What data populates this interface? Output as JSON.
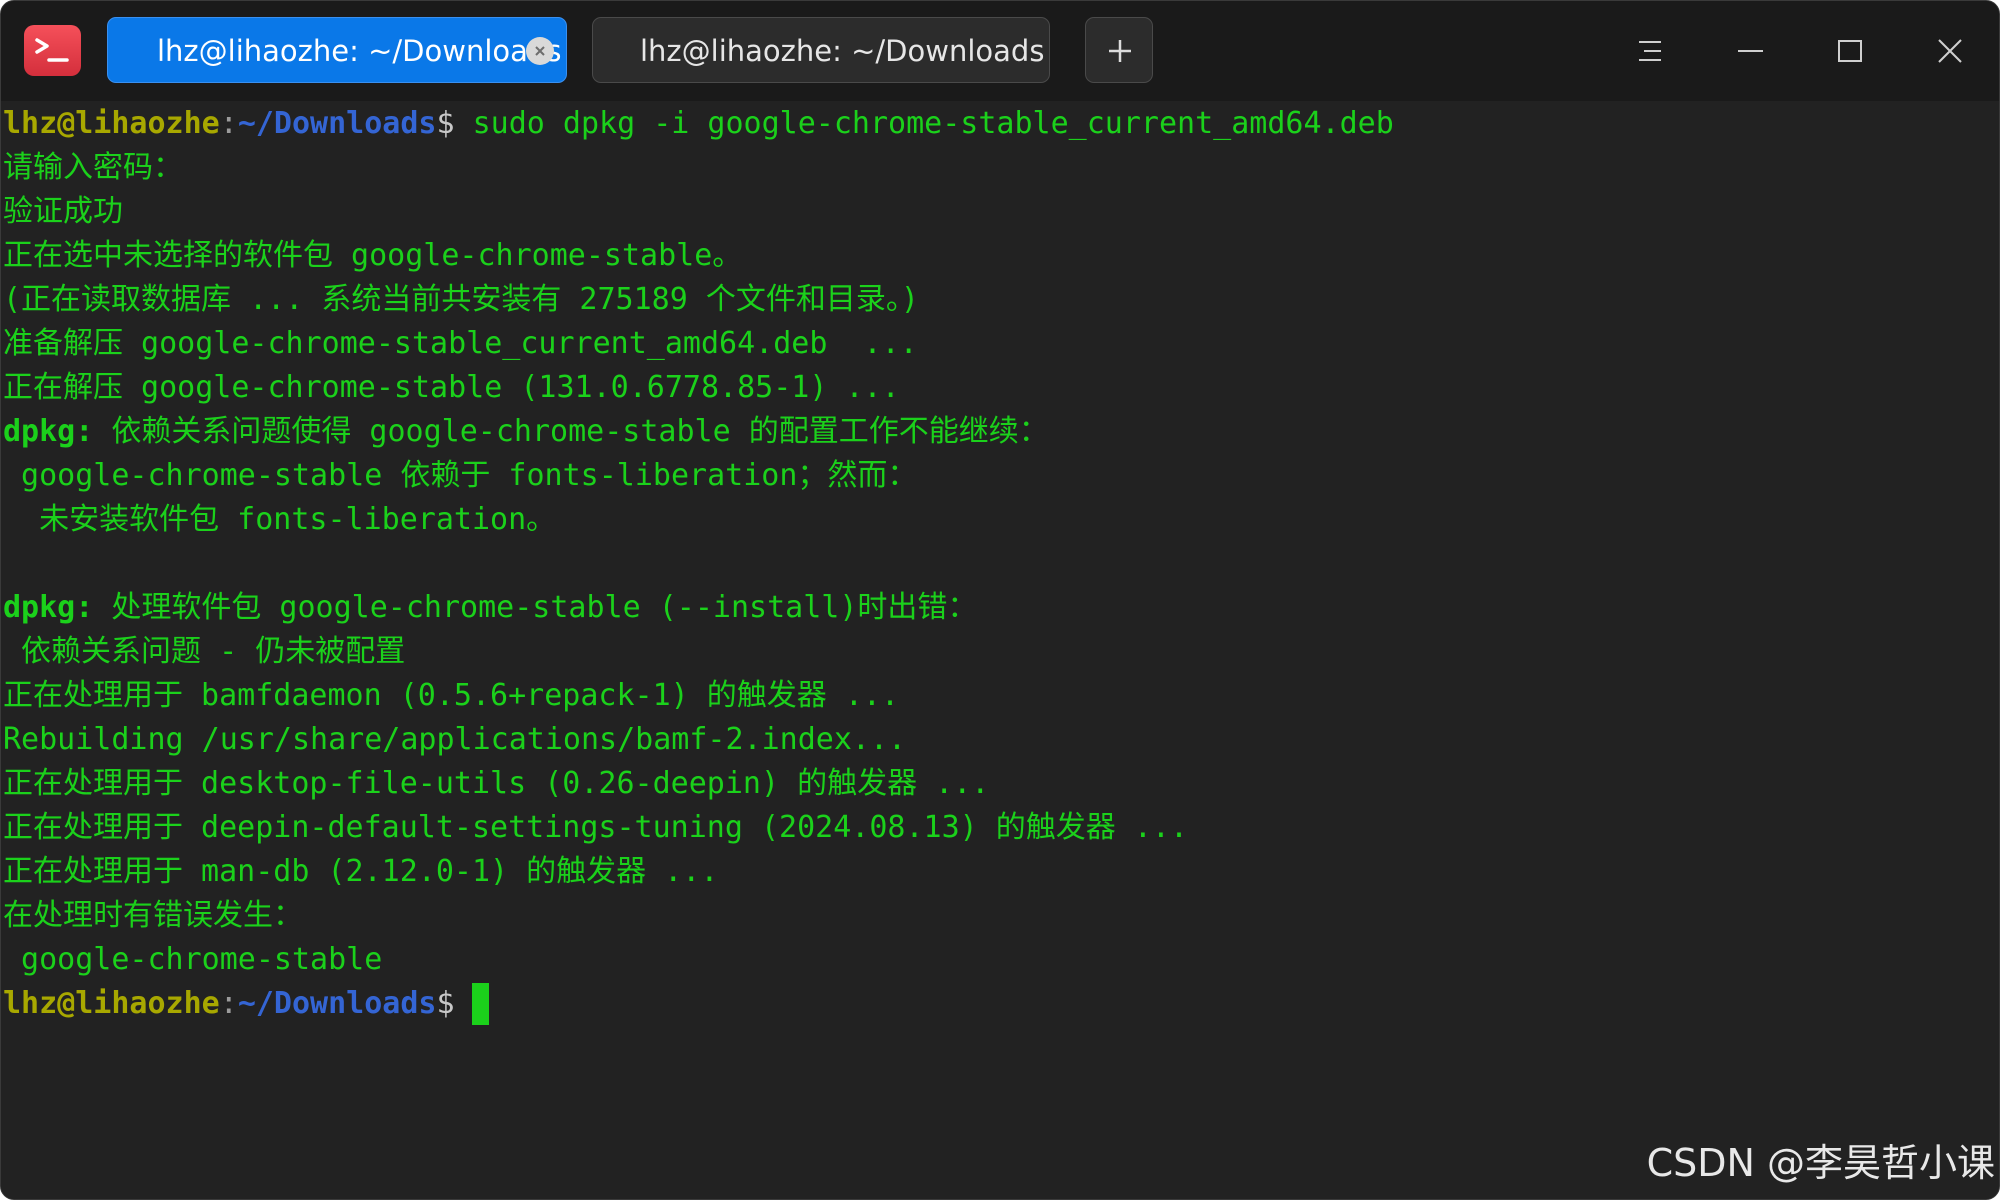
{
  "colors": {
    "window_bg": "#222222",
    "titlebar_bg": "#1a1a1a",
    "active_tab": "#0a78e8",
    "output_green": "#1bd11b",
    "prompt_user": "#a8a800",
    "prompt_path": "#3465d4"
  },
  "titlebar": {
    "app_icon": "terminal-icon",
    "tabs": [
      {
        "label": "lhz@lihaozhe: ~/Downloads",
        "active": true,
        "close_icon": "close-icon"
      },
      {
        "label": "lhz@lihaozhe: ~/Downloads",
        "active": false
      }
    ],
    "new_tab_icon": "plus-icon",
    "window_controls": [
      "menu-icon",
      "minimize-icon",
      "maximize-icon",
      "close-icon"
    ]
  },
  "terminal": {
    "prompt": {
      "user_host": "lhz@lihaozhe",
      "separator": ":",
      "path": "~/Downloads",
      "dollar": "$"
    },
    "command": " sudo dpkg -i google-chrome-stable_current_amd64.deb",
    "lines": [
      "请输入密码：",
      "验证成功",
      "正在选中未选择的软件包 google-chrome-stable。",
      "(正在读取数据库 ... 系统当前共安装有 275189 个文件和目录。)",
      "准备解压 google-chrome-stable_current_amd64.deb  ...",
      "正在解压 google-chrome-stable (131.0.6778.85-1) ...",
      {
        "bold": "dpkg:",
        "rest": " 依赖关系问题使得 google-chrome-stable 的配置工作不能继续："
      },
      " google-chrome-stable 依赖于 fonts-liberation；然而：",
      "  未安装软件包 fonts-liberation。",
      "",
      {
        "bold": "dpkg:",
        "rest": " 处理软件包 google-chrome-stable (--install)时出错："
      },
      " 依赖关系问题 - 仍未被配置",
      "正在处理用于 bamfdaemon (0.5.6+repack-1) 的触发器 ...",
      "Rebuilding /usr/share/applications/bamf-2.index...",
      "正在处理用于 desktop-file-utils (0.26-deepin) 的触发器 ...",
      "正在处理用于 deepin-default-settings-tuning (2024.08.13) 的触发器 ...",
      "正在处理用于 man-db (2.12.0-1) 的触发器 ...",
      "在处理时有错误发生：",
      " google-chrome-stable"
    ]
  },
  "watermark": "CSDN @李昊哲小课"
}
